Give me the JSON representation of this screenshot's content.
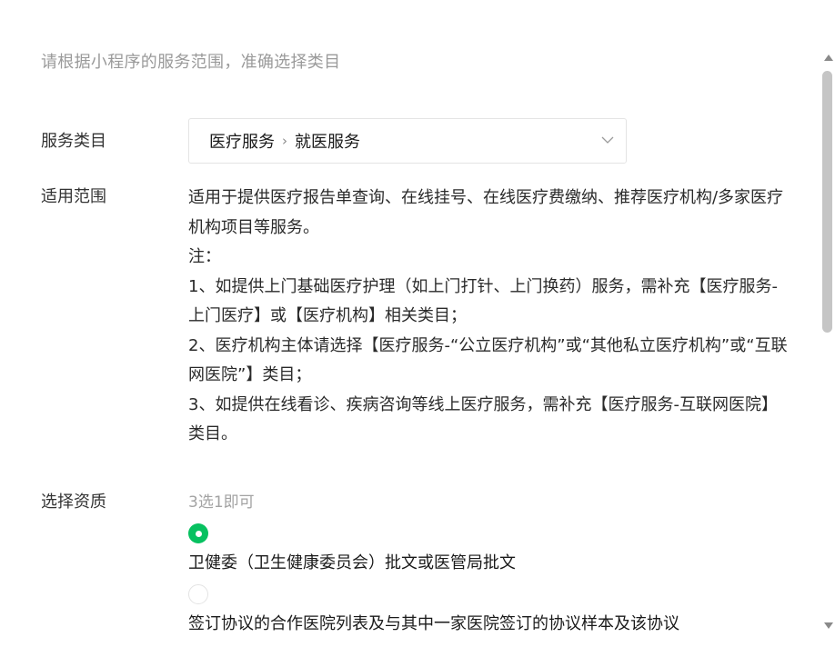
{
  "hint_text": "请根据小程序的服务范围，准确选择类目",
  "category": {
    "label": "服务类目",
    "path": [
      "医疗服务",
      "就医服务"
    ],
    "separator": "›",
    "dropdown_icon": "chevron-down-icon"
  },
  "scope": {
    "label": "适用范围",
    "lines": [
      "适用于提供医疗报告单查询、在线挂号、在线医疗费缴纳、推荐医疗机构/多家医疗机构项目等服务。",
      "注：",
      "1、如提供上门基础医疗护理（如上门打针、上门换药）服务，需补充【医疗服务-上门医疗】或【医疗机构】相关类目；",
      "2、医疗机构主体请选择【医疗服务-“公立医疗机构”或“其他私立医疗机构”或“互联网医院”】类目；",
      "3、如提供在线看诊、疾病咨询等线上医疗服务，需补充【医疗服务-互联网医院】类目。"
    ]
  },
  "qualification": {
    "label": "选择资质",
    "hint": "3选1即可",
    "options": [
      {
        "label": "卫健委（卫生健康委员会）批文或医管局批文",
        "selected": true
      },
      {
        "label": "签订协议的合作医院列表及与其中一家医院签订的协议样本及该协议",
        "selected": false
      }
    ]
  },
  "colors": {
    "accent": "#07c160",
    "hint": "#9a9a9a",
    "border": "#e4e4e4"
  }
}
